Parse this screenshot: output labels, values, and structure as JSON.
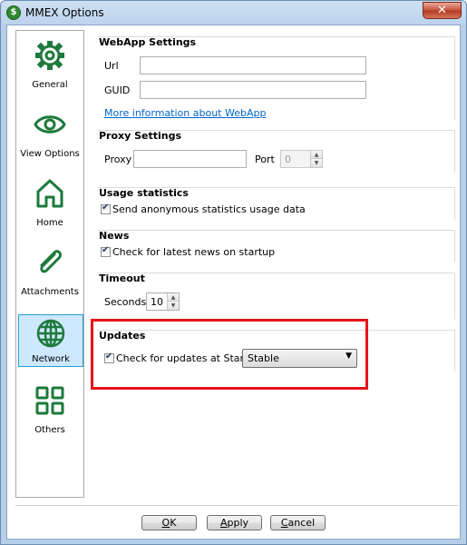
{
  "window": {
    "title": "MMEX Options",
    "close_label": "✕"
  },
  "sidebar": {
    "items": [
      {
        "label": "General",
        "icon": "gear-icon"
      },
      {
        "label": "View Options",
        "icon": "eye-icon"
      },
      {
        "label": "Home",
        "icon": "home-icon"
      },
      {
        "label": "Attachments",
        "icon": "paperclip-icon"
      },
      {
        "label": "Network",
        "icon": "globe-icon",
        "selected": true
      },
      {
        "label": "Others",
        "icon": "grid-icon"
      }
    ]
  },
  "webapp": {
    "title": "WebApp Settings",
    "url_label": "Url",
    "url_value": "",
    "guid_label": "GUID",
    "guid_value": "",
    "link": "More information about WebApp"
  },
  "proxy": {
    "title": "Proxy Settings",
    "proxy_label": "Proxy",
    "proxy_value": "",
    "port_label": "Port",
    "port_value": "0"
  },
  "usage": {
    "title": "Usage statistics",
    "checkbox_label": "Send anonymous statistics usage data",
    "checked": true
  },
  "news": {
    "title": "News",
    "checkbox_label": "Check for latest news on startup",
    "checked": true
  },
  "timeout": {
    "title": "Timeout",
    "seconds_label": "Seconds",
    "seconds_value": "10"
  },
  "updates": {
    "title": "Updates",
    "checkbox_label": "Check for updates at StartUp",
    "checked": true,
    "channel_value": "Stable"
  },
  "buttons": {
    "ok_mnemonic": "O",
    "ok_rest": "K",
    "apply_mnemonic": "A",
    "apply_rest": "pply",
    "cancel_mnemonic": "C",
    "cancel_rest": "ancel"
  },
  "colors": {
    "highlight": "#e5141b",
    "selected_bg": "#cde8ff",
    "icon_green": "#1e7a3c",
    "link": "#0066cc"
  }
}
